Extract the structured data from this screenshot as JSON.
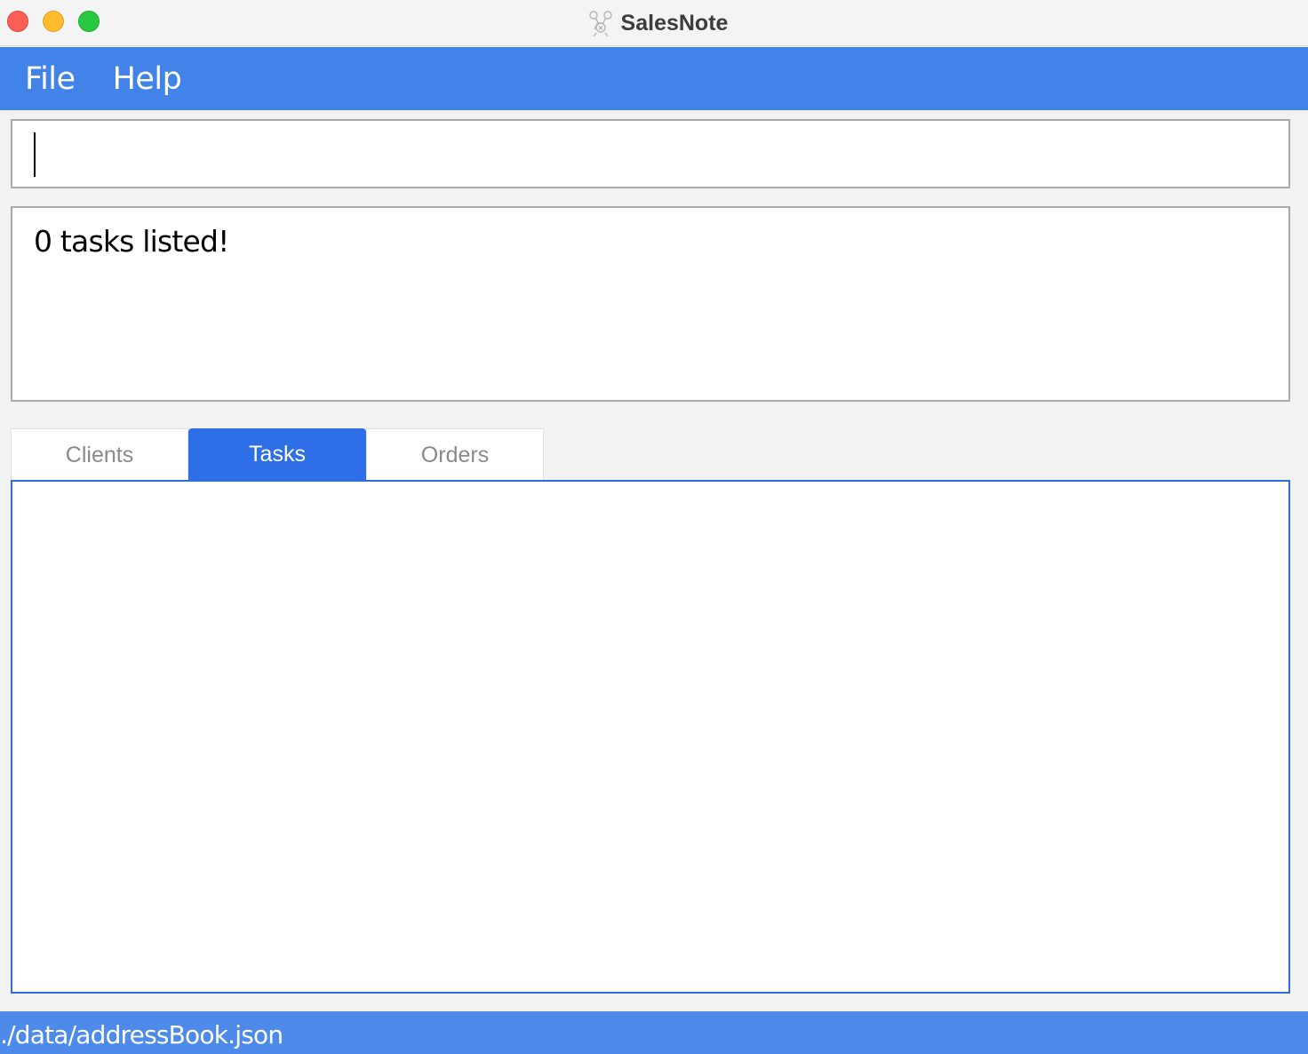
{
  "window": {
    "title": "SalesNote",
    "app_icon": "salesnote-app-icon"
  },
  "menubar": {
    "items": [
      {
        "label": "File"
      },
      {
        "label": "Help"
      }
    ]
  },
  "command_box": {
    "value": "",
    "placeholder": ""
  },
  "result_display": {
    "text": "0 tasks listed!"
  },
  "tabs": [
    {
      "label": "Clients",
      "active": false
    },
    {
      "label": "Tasks",
      "active": true
    },
    {
      "label": "Orders",
      "active": false
    }
  ],
  "list_panel": {
    "items": []
  },
  "statusbar": {
    "file_path": "./data/addressBook.json"
  },
  "colors": {
    "menubar_bg": "#4183e8",
    "active_tab_bg": "#2e6ee6",
    "statusbar_bg": "#4d8aea",
    "list_border": "#2f6fdc"
  }
}
